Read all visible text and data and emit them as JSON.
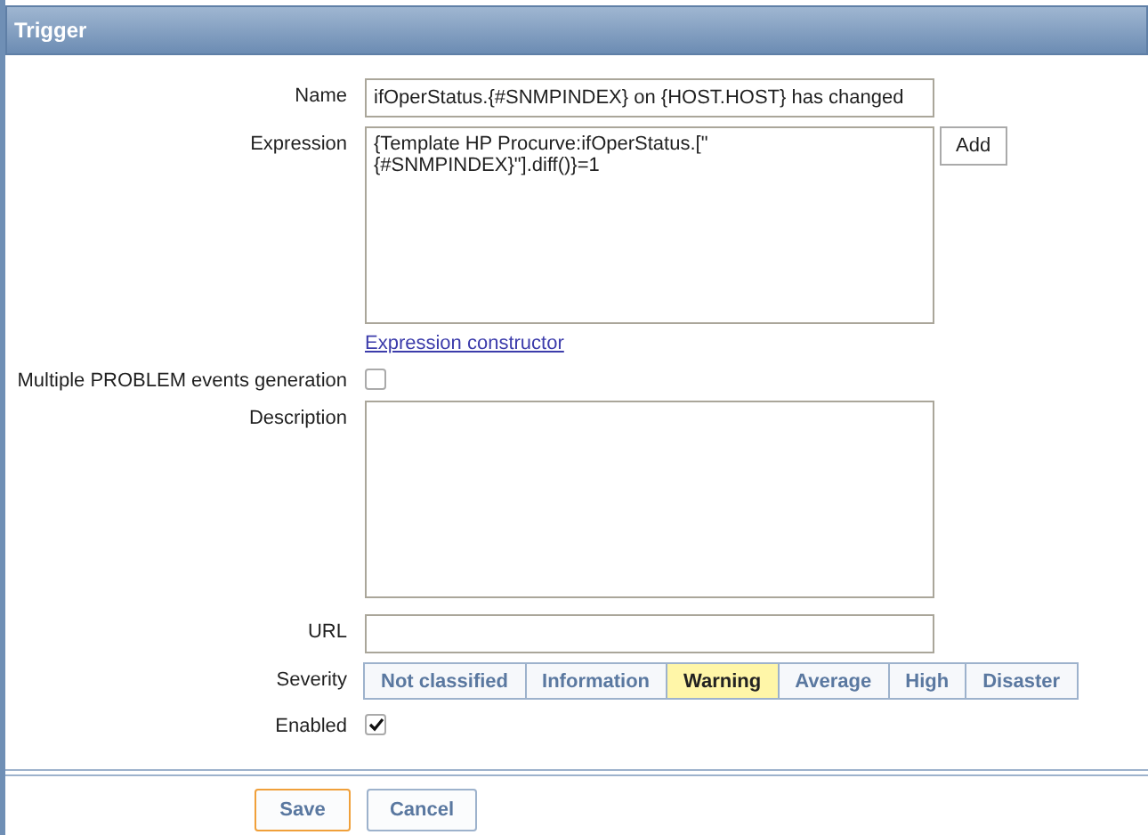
{
  "header": {
    "title": "Trigger"
  },
  "form": {
    "name_label": "Name",
    "name_value": "ifOperStatus.{#SNMPINDEX} on {HOST.HOST} has changed",
    "expression_label": "Expression",
    "expression_value": "{Template HP Procurve:ifOperStatus.[\"{#SNMPINDEX}\"].diff()}=1",
    "add_button": "Add",
    "constructor_link": "Expression constructor",
    "multiple_label": "Multiple PROBLEM events generation",
    "multiple_checked": false,
    "description_label": "Description",
    "url_label": "URL",
    "severity_label": "Severity",
    "severities": [
      {
        "label": "Not classified",
        "selected": false
      },
      {
        "label": "Information",
        "selected": false
      },
      {
        "label": "Warning",
        "selected": true
      },
      {
        "label": "Average",
        "selected": false
      },
      {
        "label": "High",
        "selected": false
      },
      {
        "label": "Disaster",
        "selected": false
      }
    ],
    "enabled_label": "Enabled",
    "enabled_checked": true
  },
  "buttons": [
    {
      "label": "Save",
      "selected": true
    },
    {
      "label": "Cancel",
      "selected": false
    }
  ]
}
